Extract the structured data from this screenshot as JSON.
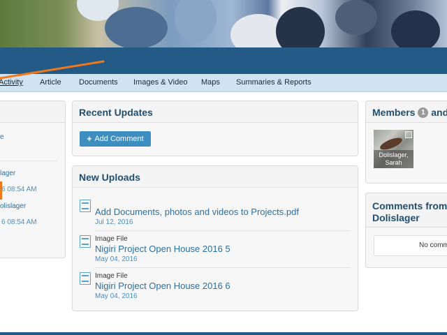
{
  "nav": {
    "items": [
      "Activity",
      "Article",
      "Documents",
      "Images & Video",
      "Maps",
      "Summaries & Reports"
    ]
  },
  "left_panel": {
    "line1": "e",
    "line2": "lager",
    "date1": "6 08:54 AM",
    "line3": "olislager",
    "date2": "6 08:54 AM"
  },
  "recent_updates": {
    "title": "Recent Updates",
    "add_comment_label": "Add Comment"
  },
  "new_uploads": {
    "title": "New Uploads",
    "items": [
      {
        "type": "",
        "name": "Add Documents, photos and videos to Projects.pdf",
        "date": "Jul 12, 2016"
      },
      {
        "type": "Image File",
        "name": "Nigiri Project Open House 2016 5",
        "date": "May 04, 2016"
      },
      {
        "type": "Image File",
        "name": "Nigiri Project Open House 2016 6",
        "date": "May 04, 2016"
      }
    ]
  },
  "members": {
    "title": "Members",
    "count": "1",
    "title_suffix": "and",
    "card_name": "Dolislager, Sarah"
  },
  "comments": {
    "title_line1": "Comments from",
    "title_line2": "Dolislager",
    "empty_text": "No comm"
  },
  "colors": {
    "blue_band": "#235b86",
    "nav_bg": "#cfe3f1",
    "accent_orange": "#f07a1a",
    "button_blue": "#3d8dbf"
  }
}
